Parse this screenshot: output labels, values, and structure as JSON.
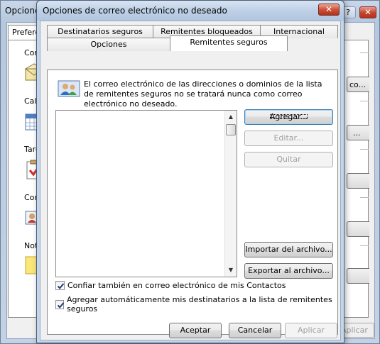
{
  "background_window": {
    "title": "Opcione",
    "tab_label": "Prefere",
    "help_glyph": "?",
    "close_glyph": "✕",
    "sections": [
      {
        "label": "Correo",
        "icon": "mail-envelope-icon"
      },
      {
        "label": "Calend",
        "icon": "calendar-icon"
      },
      {
        "label": "Tareas",
        "icon": "tasks-clipboard-icon"
      },
      {
        "label": "Conta",
        "icon": "contacts-card-icon"
      },
      {
        "label": "Notas",
        "icon": "notes-icon"
      }
    ],
    "buttons": [
      "co...",
      "...",
      "",
      "",
      ""
    ],
    "apply_label": "Aplicar"
  },
  "dialog": {
    "title": "Opciones de correo electrónico no deseado",
    "close_glyph": "✕",
    "tabs_back": [
      "Destinatarios seguros",
      "Remitentes bloqueados",
      "Internacional"
    ],
    "tabs_front": [
      "Opciones",
      "Remitentes seguros"
    ],
    "selected_tab": "Remitentes seguros",
    "info_text": "El correo electrónico de las direcciones o dominios de la lista de remitentes seguros no se tratará nunca como correo electrónico no deseado.",
    "safe_senders_list": [],
    "buttons": {
      "add": "Agregar...",
      "edit": "Editar...",
      "remove": "Quitar",
      "import": "Importar del archivo...",
      "export": "Exportar al archivo..."
    },
    "checkboxes": [
      {
        "label": "Confiar también en correo electrónico de mis Contactos",
        "checked": true
      },
      {
        "label": "Agregar automáticamente mis destinatarios a la lista de remitentes seguros",
        "checked": true
      }
    ],
    "footer": {
      "ok": "Aceptar",
      "cancel": "Cancelar",
      "apply": "Aplicar"
    }
  },
  "colors": {
    "titlebar": "#c6d6ea",
    "close_button": "#c5432d",
    "default_button_border": "#3c7fb1"
  }
}
